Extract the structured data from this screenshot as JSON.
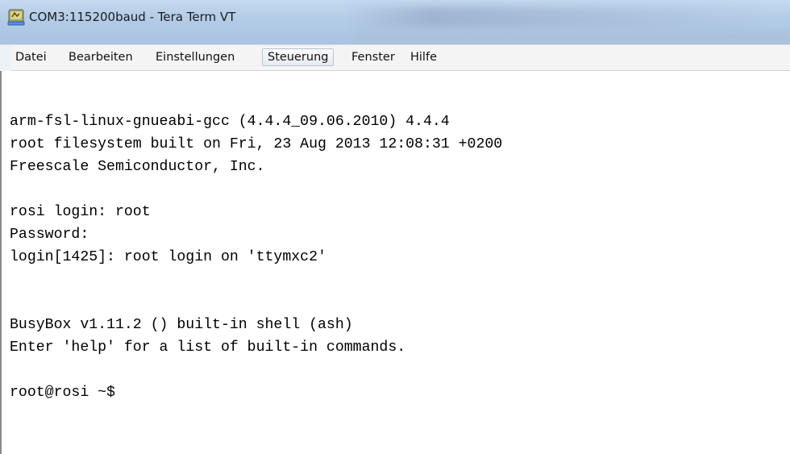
{
  "window": {
    "title": "COM3:115200baud - Tera Term VT",
    "icon": "tera-term-app-icon"
  },
  "menubar": {
    "items": [
      {
        "label": "Datei"
      },
      {
        "label": "Bearbeiten"
      },
      {
        "label": "Einstellungen"
      },
      {
        "label": "Steuerung",
        "active": true
      },
      {
        "label": "Fenster"
      },
      {
        "label": "Hilfe"
      }
    ]
  },
  "terminal": {
    "background": "#ffffff",
    "foreground": "#000000",
    "lines": [
      "arm-fsl-linux-gnueabi-gcc (4.4.4_09.06.2010) 4.4.4",
      "root filesystem built on Fri, 23 Aug 2013 12:08:31 +0200",
      "Freescale Semiconductor, Inc.",
      "",
      "rosi login: root",
      "Password:",
      "login[1425]: root login on 'ttymxc2'",
      "",
      "",
      "BusyBox v1.11.2 () built-in shell (ash)",
      "Enter 'help' for a list of built-in commands.",
      "",
      "root@rosi ~$"
    ]
  }
}
